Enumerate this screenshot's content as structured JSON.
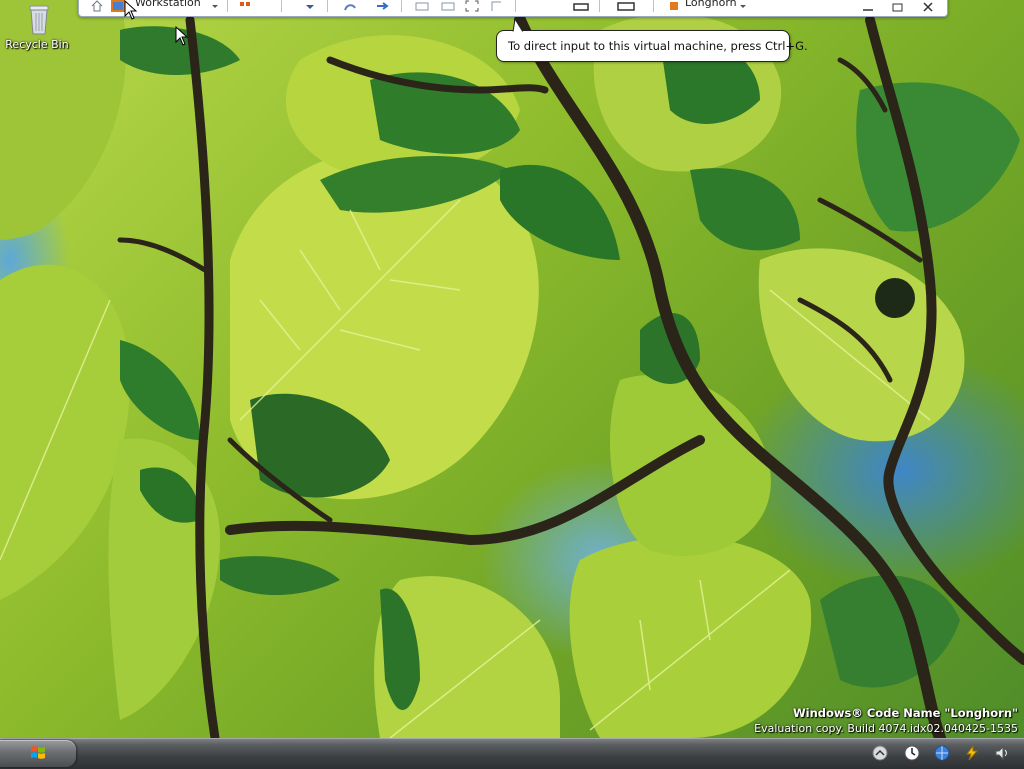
{
  "desktop": {
    "icons": [
      {
        "label": "Recycle Bin",
        "icon": "recycle-bin-icon"
      }
    ],
    "wallpaper": "green-leaves"
  },
  "vm_toolbar": {
    "workstation_label": "Workstation",
    "machine_label": "Longhorn",
    "icons": [
      "home-icon",
      "vm-icon",
      "power-icon",
      "dropdown-icon",
      "snapshot-icon",
      "revert-icon",
      "view-icon",
      "fullscreen-icon",
      "unity-icon",
      "console-icon",
      "machine-icon",
      "minimize-icon",
      "restore-icon",
      "close-icon"
    ]
  },
  "tooltip": {
    "text": "To direct input to this virtual machine, press Ctrl+G."
  },
  "watermark": {
    "line1": "Windows® Code Name \"Longhorn\"",
    "line2": "Evaluation copy. Build 4074.idx02.040425-1535"
  },
  "taskbar": {
    "start_icon": "windows-flag-icon",
    "tray_icons": [
      "chevron-up-icon",
      "clock-icon",
      "network-icon",
      "power-icon",
      "volume-icon"
    ]
  },
  "colors": {
    "taskbar": "#3d4043",
    "tooltip_bg": "#ffffff",
    "leaf_light": "#c6e04e",
    "leaf_dark": "#3e8a2a",
    "sky": "#3f86c9"
  }
}
